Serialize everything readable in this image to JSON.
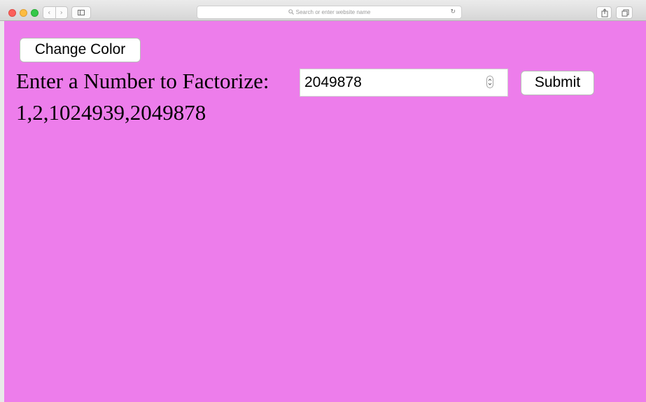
{
  "browser": {
    "address_placeholder": "Search or enter website name",
    "icons": {
      "close": "red-close-icon",
      "minimize": "yellow-minimize-icon",
      "zoom": "green-zoom-icon",
      "back": "chevron-left-icon",
      "forward": "chevron-right-icon",
      "sidebar": "sidebar-icon",
      "search": "search-icon",
      "reload": "reload-icon",
      "share": "share-icon",
      "tabs": "tabs-icon"
    }
  },
  "page": {
    "background_color": "#ed7deb",
    "change_color_label": "Change Color",
    "prompt_label": "Enter a Number to Factorize:",
    "number_value": "2049878",
    "submit_label": "Submit",
    "result_text": "1,2,1024939,2049878"
  }
}
